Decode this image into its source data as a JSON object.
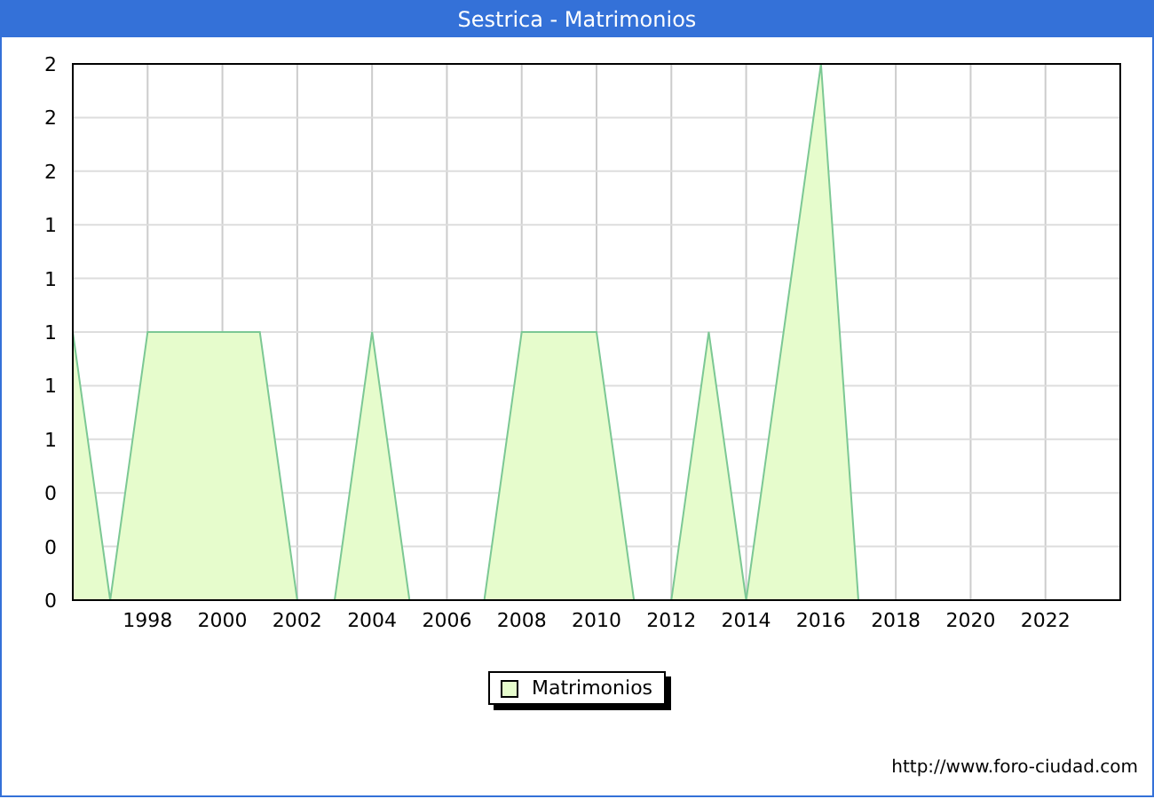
{
  "window": {
    "title": "Sestrica - Matrimonios"
  },
  "chart": {
    "chart_data": {
      "type": "area",
      "x": [
        1996,
        1997,
        1998,
        1999,
        2000,
        2001,
        2002,
        2003,
        2004,
        2005,
        2006,
        2007,
        2008,
        2009,
        2010,
        2011,
        2012,
        2013,
        2014,
        2015,
        2016,
        2017
      ],
      "series": [
        {
          "name": "Matrimonios",
          "color": "#e6fccc",
          "values": [
            1,
            0,
            1,
            1,
            1,
            1,
            0,
            0,
            1,
            0,
            0,
            0,
            1,
            1,
            1,
            0,
            0,
            1,
            0,
            1,
            2,
            0
          ]
        }
      ],
      "grid": true,
      "xlim": [
        1996,
        2024
      ],
      "ylim": [
        0,
        2
      ],
      "xticks": [
        1998,
        2000,
        2002,
        2004,
        2006,
        2008,
        2010,
        2012,
        2014,
        2016,
        2018,
        2020,
        2022
      ],
      "yticks": [
        {
          "value": 0,
          "label": "0"
        },
        {
          "value": 0.2,
          "label": "0"
        },
        {
          "value": 0.4,
          "label": "0"
        },
        {
          "value": 0.6,
          "label": "1"
        },
        {
          "value": 0.8,
          "label": "1"
        },
        {
          "value": 1,
          "label": "1"
        },
        {
          "value": 1.2,
          "label": "1"
        },
        {
          "value": 1.4,
          "label": "1"
        },
        {
          "value": 1.6,
          "label": "2"
        },
        {
          "value": 1.8,
          "label": "2"
        },
        {
          "value": 2,
          "label": "2"
        }
      ]
    }
  },
  "footer": {
    "url": "http://www.foro-ciudad.com"
  }
}
